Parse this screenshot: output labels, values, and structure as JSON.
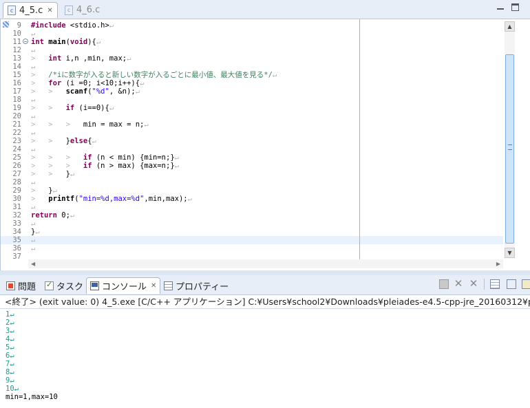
{
  "editor_tabs": [
    {
      "icon": "c-file-icon",
      "label": "4_5.c",
      "close": "✕",
      "active": true
    },
    {
      "icon": "c-file-icon",
      "label": "4_6.c",
      "active": false
    }
  ],
  "code_lines": [
    {
      "num": "9",
      "fold": false,
      "html": "<span class='kw'>#include</span> &lt;stdio.h&gt;<span class='ws'>↵</span>"
    },
    {
      "num": "10",
      "fold": false,
      "html": "<span class='ws'>↵</span>"
    },
    {
      "num": "11",
      "fold": true,
      "html": "<span class='kw'>int</span> <b>main</b>(<span class='kw'>void</span>){<span class='ws'>↵</span>"
    },
    {
      "num": "12",
      "fold": false,
      "html": "<span class='ws'>↵</span>"
    },
    {
      "num": "13",
      "fold": false,
      "html": "<span class='ws'>&gt;</span>   <span class='kw'>int</span> i,n ,min, max;<span class='ws'>↵</span>"
    },
    {
      "num": "14",
      "fold": false,
      "html": "<span class='ws'>↵</span>"
    },
    {
      "num": "15",
      "fold": false,
      "html": "<span class='ws'>&gt;</span>   <span class='cm'>/*iに数字が入ると新しい数字が入るごとに最小値、最大値を見る*/</span><span class='ws'>↵</span>"
    },
    {
      "num": "16",
      "fold": false,
      "html": "<span class='ws'>&gt;</span>   <span class='kw'>for</span> (i =0; i&lt;10;i++){<span class='ws'>↵</span>"
    },
    {
      "num": "17",
      "fold": false,
      "html": "<span class='ws'>&gt;   &gt;</span>   <b>scanf</b>(<span class='str'>\"%d\"</span>, &amp;n);<span class='ws'>↵</span>"
    },
    {
      "num": "18",
      "fold": false,
      "html": "<span class='ws'>↵</span>"
    },
    {
      "num": "19",
      "fold": false,
      "html": "<span class='ws'>&gt;   &gt;</span>   <span class='kw'>if</span> (i==0){<span class='ws'>↵</span>"
    },
    {
      "num": "20",
      "fold": false,
      "html": "<span class='ws'>↵</span>"
    },
    {
      "num": "21",
      "fold": false,
      "html": "<span class='ws'>&gt;   &gt;   &gt;</span>   min = max = n;<span class='ws'>↵</span>"
    },
    {
      "num": "22",
      "fold": false,
      "html": "<span class='ws'>↵</span>"
    },
    {
      "num": "23",
      "fold": false,
      "html": "<span class='ws'>&gt;   &gt;</span>   }<span class='kw'>else</span>{<span class='ws'>↵</span>"
    },
    {
      "num": "24",
      "fold": false,
      "html": "<span class='ws'>↵</span>"
    },
    {
      "num": "25",
      "fold": false,
      "html": "<span class='ws'>&gt;   &gt;   &gt;</span>   <span class='kw'>if</span> (n &lt; min) {min=n;}<span class='ws'>↵</span>"
    },
    {
      "num": "26",
      "fold": false,
      "html": "<span class='ws'>&gt;   &gt;   &gt;</span>   <span class='kw'>if</span> (n &gt; max) {max=n;}<span class='ws'>↵</span>"
    },
    {
      "num": "27",
      "fold": false,
      "html": "<span class='ws'>&gt;   &gt;</span>   }<span class='ws'>↵</span>"
    },
    {
      "num": "28",
      "fold": false,
      "html": "<span class='ws'>↵</span>"
    },
    {
      "num": "29",
      "fold": false,
      "html": "<span class='ws'>&gt;</span>   }<span class='ws'>↵</span>"
    },
    {
      "num": "30",
      "fold": false,
      "html": "<span class='ws'>&gt;</span>   <b>printf</b>(<span class='str'>\"min=%d,max=%d\"</span>,min,max);<span class='ws'>↵</span>"
    },
    {
      "num": "31",
      "fold": false,
      "html": "<span class='ws'>↵</span>"
    },
    {
      "num": "32",
      "fold": false,
      "html": "<span class='kw'>return</span> 0;<span class='ws'>↵</span>"
    },
    {
      "num": "33",
      "fold": false,
      "html": "<span class='ws'>↵</span>"
    },
    {
      "num": "34",
      "fold": false,
      "html": "}<span class='ws'>↵</span>"
    },
    {
      "num": "35",
      "fold": false,
      "current": true,
      "html": "<span class='ws'>↵</span>"
    },
    {
      "num": "36",
      "fold": false,
      "html": "<span class='ws'>↵</span>"
    },
    {
      "num": "37",
      "fold": false,
      "html": ""
    }
  ],
  "panel_tabs": [
    {
      "icon": "problems-icon",
      "label": "問題",
      "active": false
    },
    {
      "icon": "tasks-icon",
      "label": "タスク",
      "active": false
    },
    {
      "icon": "console-icon",
      "label": "コンソール",
      "close": "✕",
      "active": true
    },
    {
      "icon": "properties-icon",
      "label": "プロパティー",
      "active": false
    }
  ],
  "console": {
    "header": "<終了> (exit value: 0) 4_5.exe [C/C++ アプリケーション] C:¥Users¥school2¥Downloads¥pleiades-e4.5-cpp-jre_20160312¥pleiades¥",
    "input_lines": [
      "1↵",
      "2↵",
      "3↵",
      "4↵",
      "5↵",
      "6↵",
      "7↵",
      "8↵",
      "9↵",
      "10↵"
    ],
    "output": "min=1,max=10"
  },
  "colors": {
    "keyword": "#7f0055",
    "string": "#2a00ff",
    "comment": "#3f7f5f",
    "console_input": "#1c9c8c"
  }
}
